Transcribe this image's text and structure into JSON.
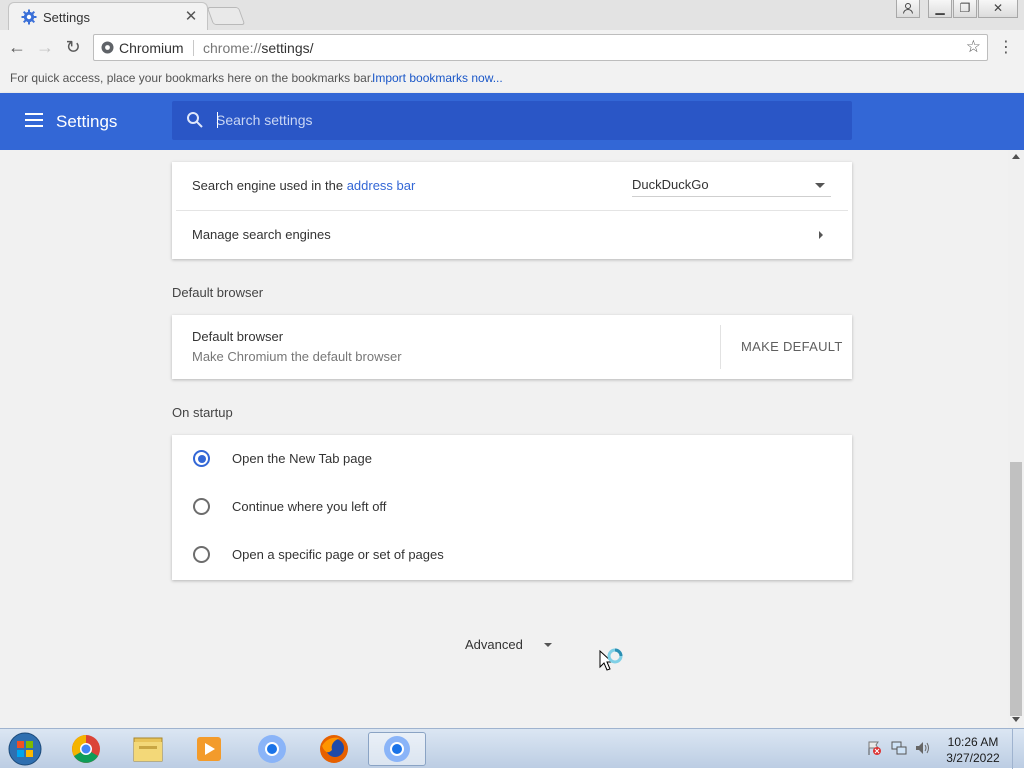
{
  "window": {
    "tab_title": "Settings",
    "tab_icon": "settings-gear-icon",
    "controls": [
      "user-icon",
      "minimize-icon",
      "restore-icon",
      "close-icon"
    ]
  },
  "toolbar": {
    "site_label": "Chromium",
    "url_prefix": "chrome://",
    "url_path": "settings/"
  },
  "bookmarks_bar": {
    "hint": "For quick access, place your bookmarks here on the bookmarks bar.",
    "import_link": "Import bookmarks now..."
  },
  "header": {
    "title": "Settings",
    "search_placeholder": "Search settings",
    "color": "#3367d6"
  },
  "search_engine": {
    "label_prefix": "Search engine used in the",
    "label_link": "address bar",
    "selected": "DuckDuckGo",
    "manage_label": "Manage search engines"
  },
  "default_browser": {
    "section_title": "Default browser",
    "title": "Default browser",
    "subtitle": "Make Chromium the default browser",
    "button": "MAKE DEFAULT"
  },
  "on_startup": {
    "section_title": "On startup",
    "options": [
      {
        "label": "Open the New Tab page",
        "selected": true
      },
      {
        "label": "Continue where you left off",
        "selected": false
      },
      {
        "label": "Open a specific page or set of pages",
        "selected": false
      }
    ]
  },
  "advanced": {
    "label": "Advanced"
  },
  "taskbar": {
    "apps": [
      "start-orb-icon",
      "chrome-icon",
      "file-explorer-icon",
      "media-player-icon",
      "chromium-icon",
      "firefox-icon",
      "chromium-active-icon"
    ],
    "time": "10:26 AM",
    "date": "3/27/2022"
  }
}
